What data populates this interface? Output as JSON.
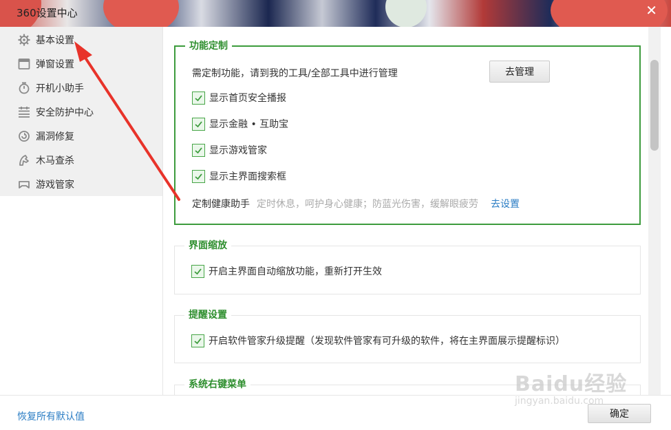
{
  "window": {
    "title": "360设置中心",
    "close_glyph": "✕"
  },
  "sidebar": {
    "items": [
      {
        "label": "基本设置",
        "icon": "gear-icon"
      },
      {
        "label": "弹窗设置",
        "icon": "window-icon"
      },
      {
        "label": "开机小助手",
        "icon": "timer-icon"
      },
      {
        "label": "安全防护中心",
        "icon": "shield-grid-icon"
      },
      {
        "label": "漏洞修复",
        "icon": "repair-icon"
      },
      {
        "label": "木马查杀",
        "icon": "trojan-icon"
      },
      {
        "label": "游戏管家",
        "icon": "gamepad-icon"
      }
    ]
  },
  "sections": {
    "custom": {
      "title": "功能定制",
      "manage_text": "需定制功能，请到我的工具/全部工具中进行管理",
      "manage_button": "去管理",
      "options": [
        {
          "label": "显示首页安全播报",
          "checked": true
        },
        {
          "label": "显示金融 • 互助宝",
          "checked": true
        },
        {
          "label": "显示游戏管家",
          "checked": true
        },
        {
          "label": "显示主界面搜索框",
          "checked": true
        }
      ],
      "health_label": "定制健康助手",
      "health_hint": "定时休息，呵护身心健康；防蓝光伤害，缓解眼疲劳",
      "health_link": "去设置"
    },
    "zoom": {
      "title": "界面缩放",
      "option": {
        "label": "开启主界面自动缩放功能，重新打开生效",
        "checked": true
      }
    },
    "remind": {
      "title": "提醒设置",
      "option": {
        "label": "开启软件管家升级提醒（发现软件管家有可升级的软件，将在主界面展示提醒标识）",
        "checked": true
      }
    },
    "context_menu": {
      "title": "系统右键菜单"
    }
  },
  "footer": {
    "reset_label": "恢复所有默认值",
    "ok_label": "确定"
  },
  "watermark": {
    "main": "Baidu经验",
    "sub": "jingyan.baidu.com"
  },
  "colors": {
    "accent_green": "#3c9b3c",
    "link_blue": "#2b7dc4",
    "arrow_red": "#e8332a"
  }
}
